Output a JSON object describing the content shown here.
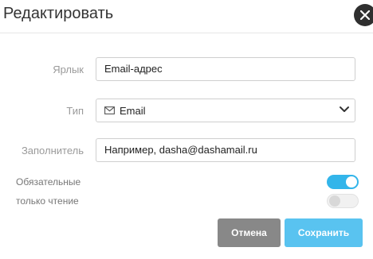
{
  "dialog": {
    "title": "Редактировать"
  },
  "form": {
    "label_field": {
      "label": "Ярлык",
      "value": "Email-адрес"
    },
    "type_field": {
      "label": "Тип",
      "selected": "Email",
      "icon": "envelope-icon"
    },
    "placeholder_field": {
      "label": "Заполнитель",
      "value": "Например, dasha@dashamail.ru"
    }
  },
  "toggles": {
    "required": {
      "label": "Обязательные",
      "enabled": true
    },
    "read_only": {
      "label": "только чтение",
      "enabled": false
    }
  },
  "buttons": {
    "cancel": "Отмена",
    "save": "Сохранить"
  },
  "colors": {
    "accent": "#33b5ea",
    "save_button": "#59c3f0",
    "cancel_button": "#888888"
  }
}
